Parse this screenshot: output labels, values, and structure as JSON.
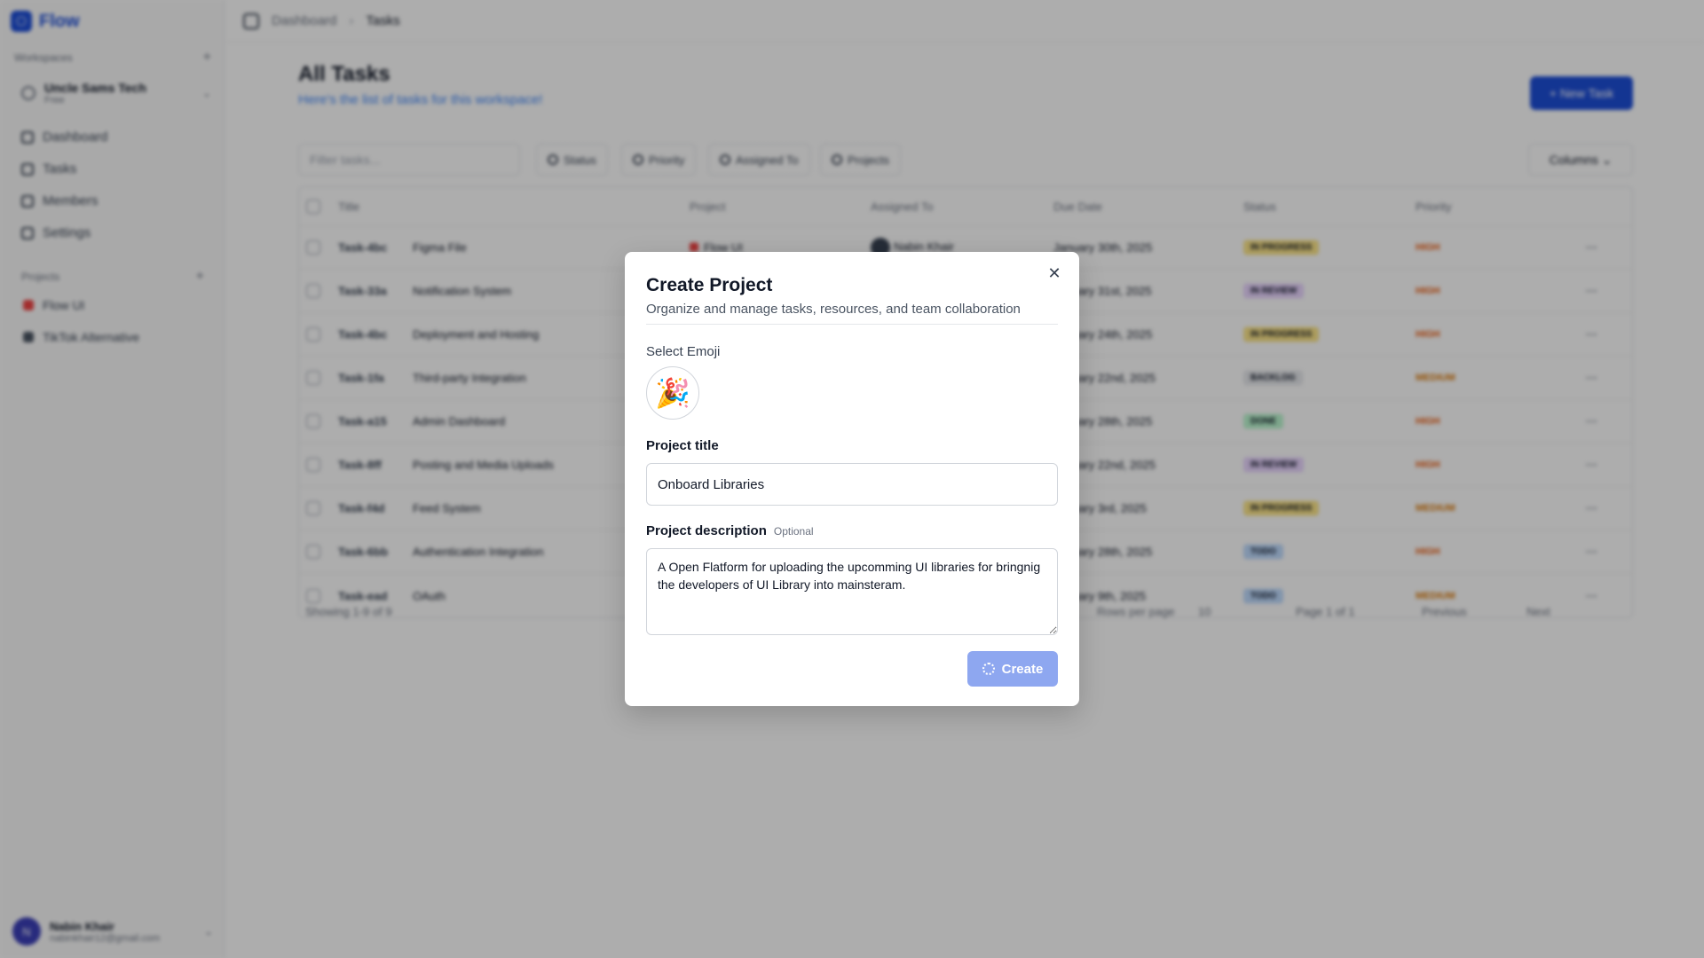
{
  "app": {
    "brand": "Flow",
    "workspaces_label": "Workspaces",
    "workspace": {
      "name": "Uncle Sams Tech",
      "plan": "Free"
    },
    "nav": [
      {
        "label": "Dashboard",
        "icon": "dashboard-icon"
      },
      {
        "label": "Tasks",
        "icon": "tasks-icon"
      },
      {
        "label": "Members",
        "icon": "members-icon"
      },
      {
        "label": "Settings",
        "icon": "settings-icon"
      }
    ],
    "projects_label": "Projects",
    "projects": [
      {
        "label": "Flow UI",
        "color": "#ef4444"
      },
      {
        "label": "TikTok Alternative",
        "color": "#4b5563"
      }
    ],
    "user": {
      "initials": "N",
      "name": "Nabin Khair",
      "email": "nabinkhair12@gmail.com"
    }
  },
  "topbar": {
    "crumb_parent": "Dashboard",
    "crumb_current": "Tasks"
  },
  "main": {
    "title": "All Tasks",
    "subtitle": "Here's the list of tasks for this workspace!",
    "new_task_label": "+ New Task",
    "filter_placeholder": "Filter tasks...",
    "filters": [
      "Status",
      "Priority",
      "Assigned To",
      "Projects"
    ],
    "columns_label": "Columns",
    "headers": [
      "Title",
      "Project",
      "Assigned To",
      "Due Date",
      "Status",
      "Priority"
    ],
    "rows": [
      {
        "id": "Task-4bc",
        "title": "Figma File",
        "project": "Flow UI",
        "assignee": "Nabin Khair",
        "due": "January 30th, 2025",
        "status": "IN PROGRESS",
        "priority": "HIGH"
      },
      {
        "id": "Task-33a",
        "title": "Notification System",
        "project": "",
        "assignee": "",
        "due": "January 31st, 2025",
        "status": "IN REVIEW",
        "priority": "HIGH"
      },
      {
        "id": "Task-4bc",
        "title": "Deployment and Hosting",
        "project": "",
        "assignee": "",
        "due": "January 24th, 2025",
        "status": "IN PROGRESS",
        "priority": "HIGH"
      },
      {
        "id": "Task-1fa",
        "title": "Third-party Integration",
        "project": "",
        "assignee": "",
        "due": "January 22nd, 2025",
        "status": "BACKLOG",
        "priority": "MEDIUM"
      },
      {
        "id": "Task-a15",
        "title": "Admin Dashboard",
        "project": "",
        "assignee": "",
        "due": "January 28th, 2025",
        "status": "DONE",
        "priority": "HIGH"
      },
      {
        "id": "Task-8ff",
        "title": "Posting and Media Uploads",
        "project": "",
        "assignee": "",
        "due": "January 22nd, 2025",
        "status": "IN REVIEW",
        "priority": "HIGH"
      },
      {
        "id": "Task-f4d",
        "title": "Feed System",
        "project": "",
        "assignee": "",
        "due": "January 3rd, 2025",
        "status": "IN PROGRESS",
        "priority": "MEDIUM"
      },
      {
        "id": "Task-6bb",
        "title": "Authentication Integration",
        "project": "",
        "assignee": "",
        "due": "January 28th, 2025",
        "status": "TODO",
        "priority": "HIGH"
      },
      {
        "id": "Task-ead",
        "title": "OAuth",
        "project": "",
        "assignee": "",
        "due": "January 9th, 2025",
        "status": "TODO",
        "priority": "MEDIUM"
      }
    ],
    "showing": "Showing 1-9 of 9",
    "rows_per_page_label": "Rows per page",
    "rows_per_page_value": "10",
    "page_label": "Page 1 of 1",
    "prev_label": "Previous",
    "next_label": "Next"
  },
  "status_colors": {
    "IN PROGRESS": "#fde68a",
    "IN REVIEW": "#e9d5ff",
    "BACKLOG": "#e5e7eb",
    "DONE": "#bbf7d0",
    "TODO": "#bfdbfe"
  },
  "priority_colors": {
    "HIGH": "#ea580c",
    "MEDIUM": "#d97706"
  },
  "modal": {
    "title": "Create Project",
    "subtitle": "Organize and manage tasks, resources, and team collaboration",
    "emoji_label": "Select Emoji",
    "emoji": "🎉",
    "title_label": "Project title",
    "title_value": "Onboard Libraries",
    "desc_label": "Project description",
    "desc_optional": "Optional",
    "desc_value": "A Open Flatform for uploading the upcomming UI libraries for bringnig the developers of UI Library into mainsteram.",
    "create_label": "Create",
    "accent": "#8ea7f0"
  }
}
